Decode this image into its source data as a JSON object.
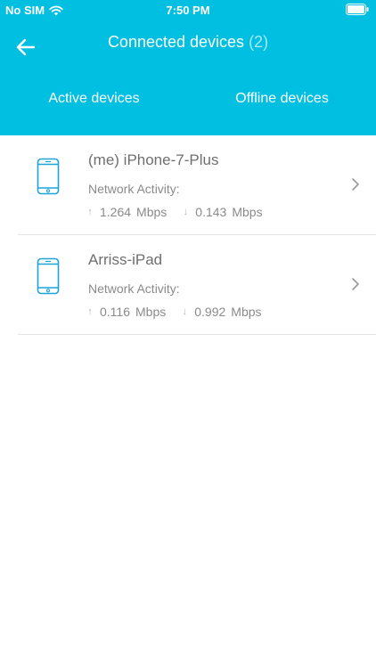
{
  "status_bar": {
    "carrier": "No SIM",
    "time": "7:50 PM",
    "wifi_icon": "wifi-icon",
    "battery_icon": "battery-icon"
  },
  "header": {
    "title": "Connected devices",
    "count": "(2)",
    "back_icon": "back-arrow-icon",
    "background_color": "#00bfe0"
  },
  "tabs": [
    {
      "label": "Active devices"
    },
    {
      "label": "Offline devices"
    }
  ],
  "devices": [
    {
      "name": "(me) iPhone-7-Plus",
      "activity_label": "Network Activity:",
      "upload": "1.264",
      "upload_unit": "Mbps",
      "download": "0.143",
      "download_unit": "Mbps"
    },
    {
      "name": "Arriss-iPad",
      "activity_label": "Network Activity:",
      "upload": "0.116",
      "upload_unit": "Mbps",
      "download": "0.992",
      "download_unit": "Mbps"
    }
  ],
  "icons": {
    "device": "phone-icon",
    "upload": "arrow-up-icon",
    "download": "arrow-down-icon",
    "row_action": "chevron-right-icon"
  },
  "colors": {
    "accent": "#00bfe0",
    "device_icon": "#1aa6d8",
    "text": "#6f6f6f"
  }
}
